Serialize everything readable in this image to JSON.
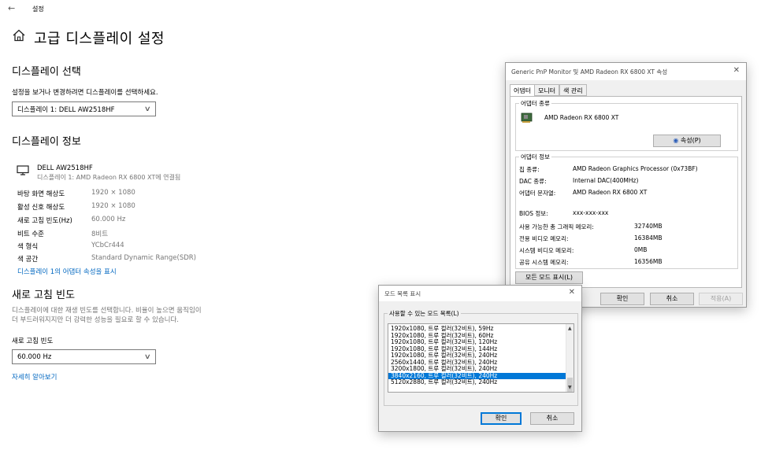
{
  "settings": {
    "app_title": "설정",
    "page_title": "고급 디스플레이 설정",
    "select_display": {
      "heading": "디스플레이 선택",
      "description": "설정을 보거나 변경하려면 디스플레이를 선택하세요.",
      "selected": "디스플레이 1: DELL AW2518HF"
    },
    "display_info": {
      "heading": "디스플레이 정보",
      "monitor_name": "DELL AW2518HF",
      "monitor_sub": "디스플레이 1: AMD Radeon RX 6800 XT에 연결됨",
      "rows": [
        {
          "key": "바탕 화면 해상도",
          "value": "1920 × 1080"
        },
        {
          "key": "활성 신호 해상도",
          "value": "1920 × 1080"
        },
        {
          "key": "새로 고침 빈도(Hz)",
          "value": "60.000 Hz"
        },
        {
          "key": "비트 수준",
          "value": "8비트"
        },
        {
          "key": "색 형식",
          "value": "YCbCr444"
        },
        {
          "key": "색 공간",
          "value": "Standard Dynamic Range(SDR)"
        }
      ],
      "adapter_link": "디스플레이 1의 어댑터 속성을 표시"
    },
    "refresh": {
      "heading": "새로 고침 빈도",
      "desc1": "디스플레이에 대한 재생 빈도를 선택합니다. 비율이 높으면 움직임이",
      "desc2": "더 부드러워지지만 더 강력한 성능을 필요로 할 수 있습니다.",
      "label": "새로 고침 빈도",
      "selected": "60.000 Hz",
      "learn_more": "자세히 알아보기"
    }
  },
  "properties_dialog": {
    "title": "Generic PnP Monitor 및 AMD Radeon RX 6800 XT 속성",
    "tabs": [
      "어댑터",
      "모니터",
      "색 관리"
    ],
    "adapter_type": {
      "label": "어댑터 종류",
      "name": "AMD Radeon RX 6800 XT",
      "properties_button": "속성(P)"
    },
    "adapter_info": {
      "label": "어댑터 정보",
      "rows": [
        {
          "key": "칩 종류:",
          "value": "AMD Radeon Graphics Processor (0x73BF)"
        },
        {
          "key": "DAC 종류:",
          "value": "Internal DAC(400MHz)"
        },
        {
          "key": "어댑터 문자열:",
          "value": "AMD Radeon RX 6800 XT"
        },
        {
          "key": "BIOS 정보:",
          "value": "xxx-xxx-xxx"
        }
      ],
      "memory": [
        {
          "key": "사용 가능한 총 그래픽 메모리:",
          "value": "32740MB"
        },
        {
          "key": "전용 비디오 메모리:",
          "value": "16384MB"
        },
        {
          "key": "시스템 비디오 메모리:",
          "value": "0MB"
        },
        {
          "key": "공유 시스템 메모리:",
          "value": "16356MB"
        }
      ]
    },
    "list_all_modes_button": "모든 모드 표시(L)",
    "ok": "확인",
    "cancel": "취소",
    "apply": "적용(A)"
  },
  "mode_dialog": {
    "title": "모드 목록 표시",
    "group_label": "사용할 수 있는 모드 목록(L)",
    "modes": [
      "1920x1080, 트루 컬러(32비트), 59Hz",
      "1920x1080, 트루 컬러(32비트), 60Hz",
      "1920x1080, 트루 컬러(32비트), 120Hz",
      "1920x1080, 트루 컬러(32비트), 144Hz",
      "1920x1080, 트루 컬러(32비트), 240Hz",
      "2560x1440, 트루 컬러(32비트), 240Hz",
      "3200x1800, 트루 컬러(32비트), 240Hz",
      "3840x2160, 트루 컬러(32비트), 240Hz",
      "5120x2880, 트루 컬러(32비트), 240Hz"
    ],
    "selected_index": 7,
    "ok": "확인",
    "cancel": "취소"
  },
  "colors": {
    "accent": "#0078d7",
    "link": "#0067c0"
  }
}
